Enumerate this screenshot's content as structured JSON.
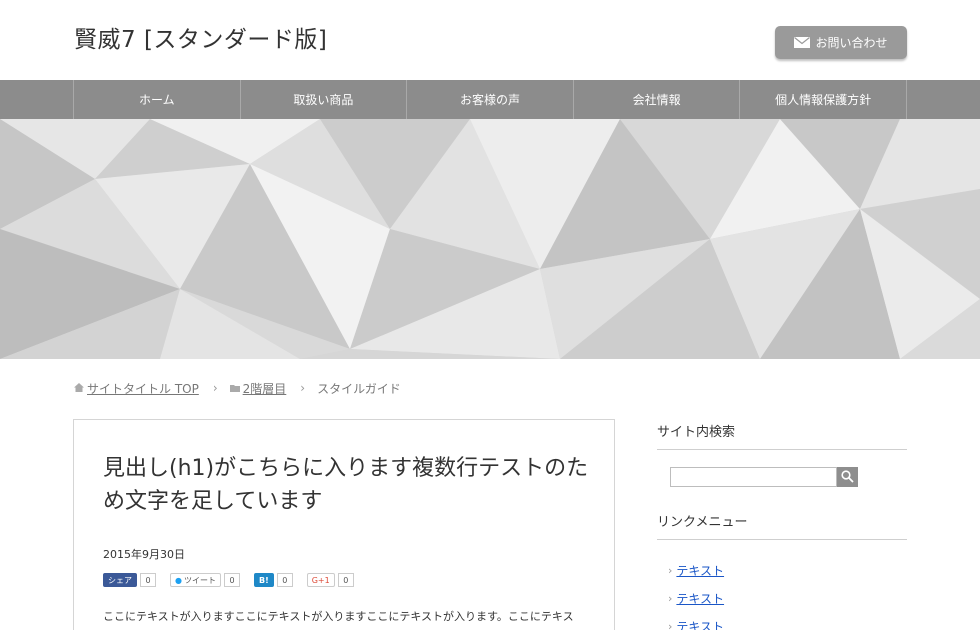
{
  "header": {
    "site_title": "賢威7 [スタンダード版]",
    "contact_label": "お問い合わせ"
  },
  "nav": {
    "items": [
      {
        "label": "ホーム"
      },
      {
        "label": "取扱い商品"
      },
      {
        "label": "お客様の声"
      },
      {
        "label": "会社情報"
      },
      {
        "label": "個人情報保護方針"
      }
    ]
  },
  "breadcrumb": {
    "home": "サイトタイトル TOP",
    "level2": "2階層目",
    "current": "スタイルガイド"
  },
  "article": {
    "title": "見出し(h1)がこちらに入ります複数行テストのため文字を足しています",
    "date": "2015年9月30日",
    "share": {
      "facebook_label": "シェア",
      "facebook_count": "0",
      "twitter_label": "ツイート",
      "twitter_count": "0",
      "hatena_label": "B!",
      "hatena_count": "0",
      "gplus_label": "G+1",
      "gplus_count": "0"
    },
    "body": "ここにテキストが入りますここにテキストが入りますここにテキストが入ります。ここにテキス"
  },
  "sidebar": {
    "search_heading": "サイト内検索",
    "search_placeholder": "",
    "link_heading": "リンクメニュー",
    "links": [
      {
        "label": "テキスト"
      },
      {
        "label": "テキスト"
      },
      {
        "label": "テキスト"
      }
    ]
  },
  "colors": {
    "nav_bg": "#8c8c8c",
    "button_bg": "#9a9a9a",
    "link": "#1a56c7"
  },
  "icons": {
    "contact": "mail-icon",
    "breadcrumb_home": "home-icon",
    "breadcrumb_folder": "folder-icon",
    "search": "search-icon"
  }
}
